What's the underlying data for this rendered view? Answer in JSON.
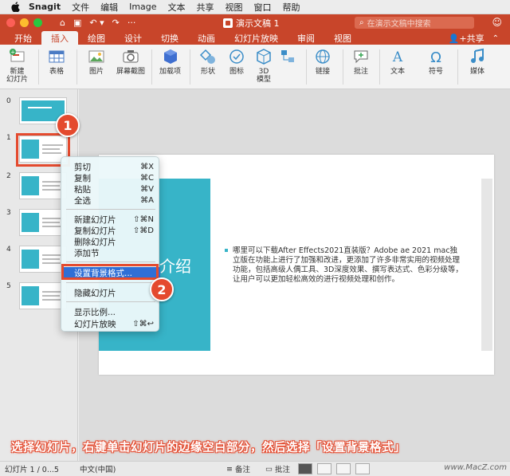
{
  "menubar": {
    "app_name": "Snagit",
    "items": [
      "文件",
      "编辑",
      "Image",
      "文本",
      "共享",
      "视图",
      "窗口",
      "帮助"
    ]
  },
  "titlebar": {
    "doc_title": "演示文稿 1",
    "search_placeholder": "在演示文稿中搜索"
  },
  "tabs": [
    "开始",
    "插入",
    "绘图",
    "设计",
    "切换",
    "动画",
    "幻灯片放映",
    "审阅",
    "视图"
  ],
  "active_tab": "插入",
  "share_label": "共享",
  "ribbon": {
    "new_slide": "新建\n幻灯片",
    "table": "表格",
    "picture": "图片",
    "screenshot": "屏幕截图",
    "addins": "加载项",
    "shapes": "形状",
    "icons": "图标",
    "model3d": "3D\n模型",
    "link": "链接",
    "comment": "批注",
    "text": "文本",
    "symbol": "符号",
    "media": "媒体"
  },
  "slide_numbers": [
    "0",
    "1",
    "2",
    "3",
    "4",
    "5"
  ],
  "context_menu": {
    "items": [
      {
        "label": "剪切",
        "shortcut": "⌘X"
      },
      {
        "label": "复制",
        "shortcut": "⌘C"
      },
      {
        "label": "粘贴",
        "shortcut": "⌘V"
      },
      {
        "label": "全选",
        "shortcut": "⌘A"
      },
      {
        "label": "新建幻灯片",
        "shortcut": "⇧⌘N"
      },
      {
        "label": "复制幻灯片",
        "shortcut": "⇧⌘D"
      },
      {
        "label": "删除幻灯片",
        "shortcut": ""
      },
      {
        "label": "添加节",
        "shortcut": ""
      },
      {
        "label": "设置背景格式...",
        "shortcut": ""
      },
      {
        "label": "隐藏幻灯片",
        "shortcut": ""
      },
      {
        "label": "显示比例...",
        "shortcut": ""
      },
      {
        "label": "幻灯片放映",
        "shortcut": "⇧⌘↩"
      }
    ]
  },
  "badges": [
    "1",
    "2"
  ],
  "slide": {
    "teal_text": "介绍",
    "body": "哪里可以下载After Effects2021直装版？Adobe ae 2021 mac独立版在功能上进行了加强和改进，更添加了许多非常实用的视频处理功能，包括高级人偶工具、3D深度效果、撰写表达式、色彩分级等，让用户可以更加轻松高效的进行视频处理和创作。"
  },
  "caption": "选择幻灯片，右键单击幻灯片的边缘空白部分，然后选择「设置背景格式」",
  "statusbar": {
    "slide_info": "幻灯片 1 / 0...5",
    "language": "中文(中国)",
    "notes": "备注",
    "comments": "批注",
    "watermark": "www.MacZ.com"
  },
  "colors": {
    "accent": "#c8452a",
    "teal": "#37b4c8",
    "highlight": "#e44a2e",
    "menu_selected": "#2f6fd6"
  }
}
